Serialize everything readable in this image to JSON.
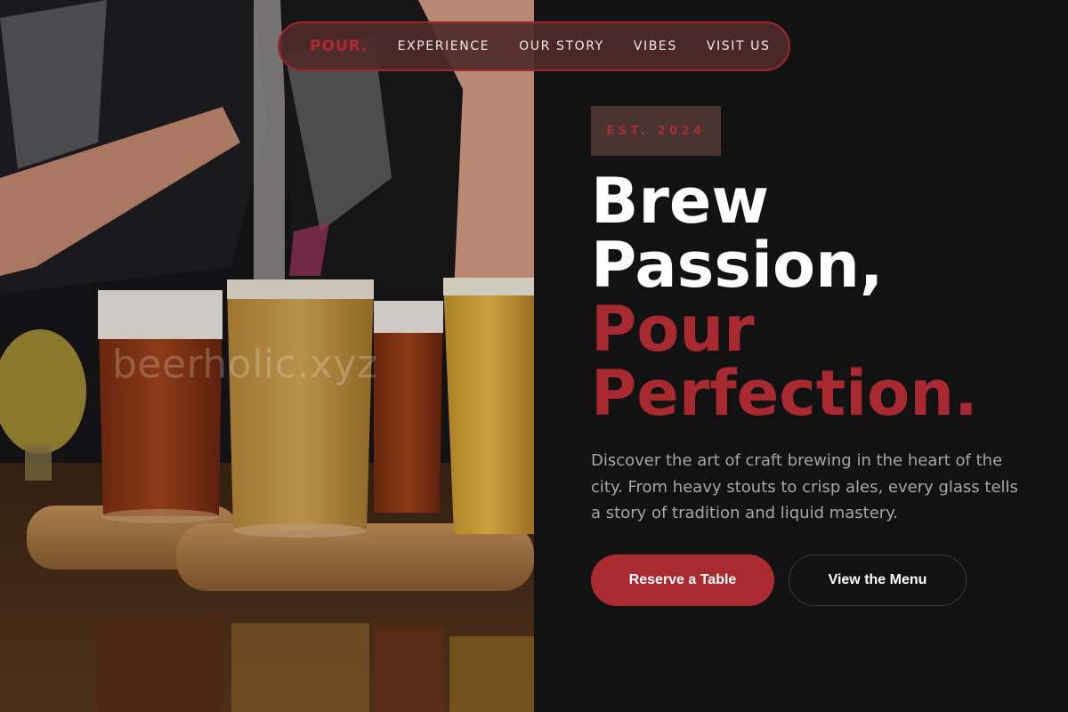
{
  "nav": {
    "logo": "POUR.",
    "links": [
      "EXPERIENCE",
      "OUR STORY",
      "VIBES",
      "VISIT US"
    ]
  },
  "image": {
    "watermark": "beerholic.xyz"
  },
  "hero": {
    "badge": "EST. 2024",
    "headline_line1": "Brew",
    "headline_line2": "Passion,",
    "headline_line3": "Pour",
    "headline_line4": "Perfection.",
    "description": "Discover the art of craft brewing in the heart of the city. From heavy stouts to crisp ales, every glass tells a story of tradition and liquid mastery.",
    "primary_button": "Reserve a Table",
    "secondary_button": "View the Menu"
  },
  "colors": {
    "accent": "#ab2a30",
    "background": "#121212",
    "badge_bg": "#4a3431"
  }
}
